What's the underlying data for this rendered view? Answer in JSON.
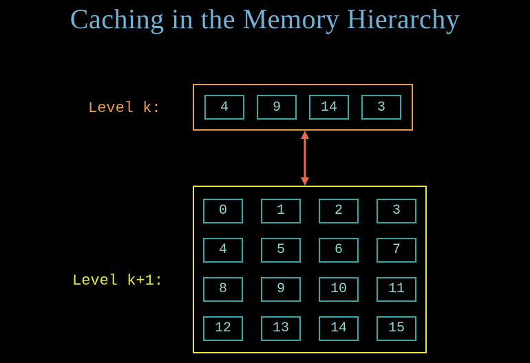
{
  "title": "Caching in the Memory Hierarchy",
  "levels": {
    "k": {
      "label": "Level k:",
      "cells": [
        "4",
        "9",
        "14",
        "3"
      ]
    },
    "k1": {
      "label": "Level k+1:",
      "rows": [
        [
          "0",
          "1",
          "2",
          "3"
        ],
        [
          "4",
          "5",
          "6",
          "7"
        ],
        [
          "8",
          "9",
          "10",
          "11"
        ],
        [
          "12",
          "13",
          "14",
          "15"
        ]
      ]
    }
  },
  "arrow": {
    "color": "#e96a4f"
  }
}
